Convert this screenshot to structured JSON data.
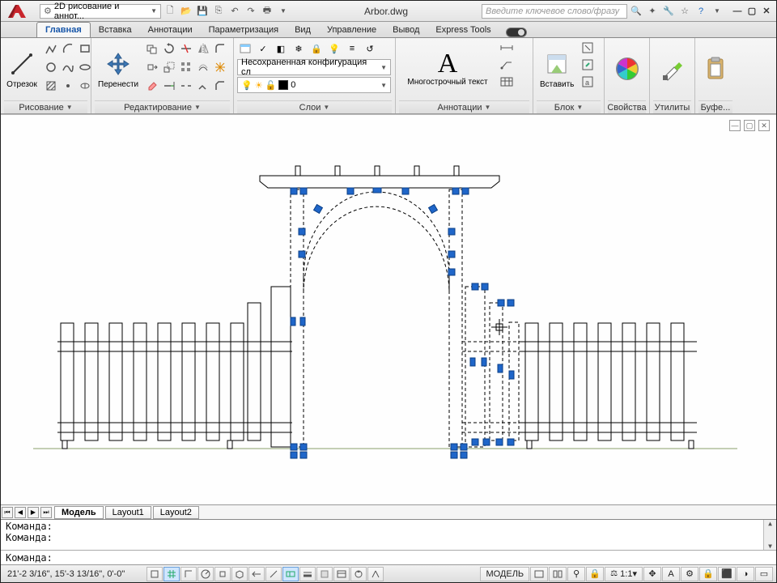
{
  "title": "Arbor.dwg",
  "workspace": "2D рисование и аннот...",
  "search_placeholder": "Введите ключевое слово/фразу",
  "tabs": {
    "home": "Главная",
    "insert": "Вставка",
    "annotate": "Аннотации",
    "parametric": "Параметризация",
    "view": "Вид",
    "manage": "Управление",
    "output": "Вывод",
    "express": "Express Tools"
  },
  "panels": {
    "draw": {
      "title": "Рисование",
      "line_label": "Отрезок"
    },
    "modify": {
      "title": "Редактирование",
      "move_label": "Перенести"
    },
    "layers": {
      "title": "Слои",
      "unsaved": "Несохраненная конфигурация сл",
      "current": "0"
    },
    "annotation": {
      "title": "Аннотации",
      "mtext_label": "Многострочный текст"
    },
    "block": {
      "title": "Блок",
      "insert_label": "Вставить"
    },
    "properties": {
      "title": "Свойства"
    },
    "utilities": {
      "title": "Утилиты"
    },
    "clipboard": {
      "title": "Буфе..."
    }
  },
  "sheet_tabs": {
    "model": "Модель",
    "l1": "Layout1",
    "l2": "Layout2"
  },
  "command": {
    "prompt": "Команда:",
    "hist1": "Команда:",
    "hist2": "Команда:"
  },
  "status": {
    "coords": "21'-2 3/16\", 15'-3 13/16\", 0'-0\"",
    "model": "МОДЕЛЬ",
    "scale": "1:1"
  }
}
